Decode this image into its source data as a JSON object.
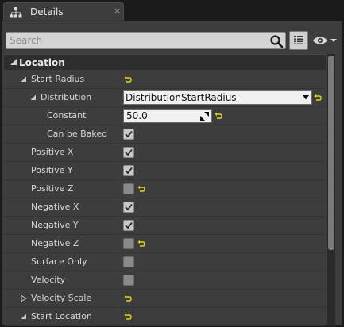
{
  "tab": {
    "title": "Details",
    "close": "×"
  },
  "search": {
    "placeholder": "Search",
    "value": ""
  },
  "category": {
    "label": "Location"
  },
  "rows": [
    {
      "label": "Start Radius"
    },
    {
      "label": "Distribution",
      "dropdown_value": "DistributionStartRadius"
    },
    {
      "label": "Constant",
      "value": "50.0"
    },
    {
      "label": "Can be Baked",
      "checked": true
    },
    {
      "label": "Positive X",
      "checked": true
    },
    {
      "label": "Positive Y",
      "checked": true
    },
    {
      "label": "Positive Z",
      "checked": false
    },
    {
      "label": "Negative X",
      "checked": true
    },
    {
      "label": "Negative Y",
      "checked": true
    },
    {
      "label": "Negative Z",
      "checked": false
    },
    {
      "label": "Surface Only",
      "checked": false
    },
    {
      "label": "Velocity",
      "checked": false
    },
    {
      "label": "Velocity Scale"
    },
    {
      "label": "Start Location"
    }
  ],
  "colors": {
    "panel_bg": "#3d3d3d",
    "header_bg": "#2e2e2e",
    "reset_arrow": "#e8d21d",
    "text": "#d6d6d6"
  },
  "icons": {
    "tab": "details-tree-icon",
    "search": "search-icon",
    "view_options": "view-options-icon",
    "eye": "eye-icon",
    "reset": "reset-to-default-icon"
  }
}
